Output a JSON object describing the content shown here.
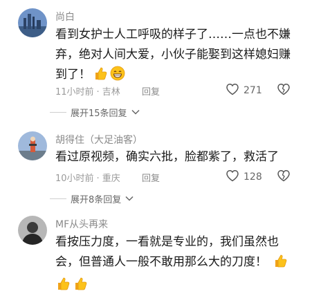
{
  "comments": [
    {
      "username": "尚白",
      "lines": [
        "看到女护士人工呼吸的样子了……一点也不嫌",
        "弃，绝对人间大爱，小伙子能娶到这样媳妇赚",
        "到了！"
      ],
      "time": "11小时前",
      "location": "吉林",
      "reply_label": "回复",
      "likes": "271",
      "expand_label": "展开15条回复"
    },
    {
      "username": "胡得住（大足油客）",
      "lines": [
        "看过原视频，确实六批，脸都紫了，救活了"
      ],
      "time": "10小时前",
      "location": "重庆",
      "reply_label": "回复",
      "likes": "128",
      "expand_label": "展开8条回复"
    },
    {
      "username": "MF从头再来",
      "lines": [
        "看按压力度，一看就是专业的，我们虽然也",
        "会，但普通人一般不敢用那么大的刀度！"
      ]
    }
  ],
  "icons": {
    "thumbs_up": "thumbs-up-emoji",
    "grin": "grinning-emoji",
    "like": "heart-icon",
    "dislike": "broken-heart-icon",
    "chevron": "chevron-down-icon"
  }
}
